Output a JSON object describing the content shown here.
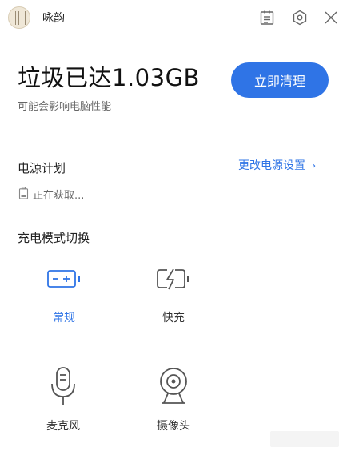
{
  "user": {
    "name": "咏韵"
  },
  "titlebar": {
    "icons": [
      "clipboard-icon",
      "gear-icon",
      "close-icon"
    ]
  },
  "hero": {
    "title": "垃圾已达1.03GB",
    "subtitle": "可能会影响电脑性能",
    "button_label": "立即清理"
  },
  "power": {
    "title": "电源计划",
    "link_label": "更改电源设置",
    "link_chevron": "›",
    "status": "正在获取..."
  },
  "charge_mode": {
    "title": "充电模式切换",
    "modes": [
      {
        "label": "常规",
        "icon": "battery-icon",
        "selected": true
      },
      {
        "label": "快充",
        "icon": "fast-charge-icon",
        "selected": false
      }
    ]
  },
  "devices": [
    {
      "label": "麦克风",
      "icon": "microphone-icon"
    },
    {
      "label": "摄像头",
      "icon": "camera-icon"
    }
  ],
  "colors": {
    "accent": "#2f74e6",
    "text": "#222222",
    "muted": "#666666"
  }
}
